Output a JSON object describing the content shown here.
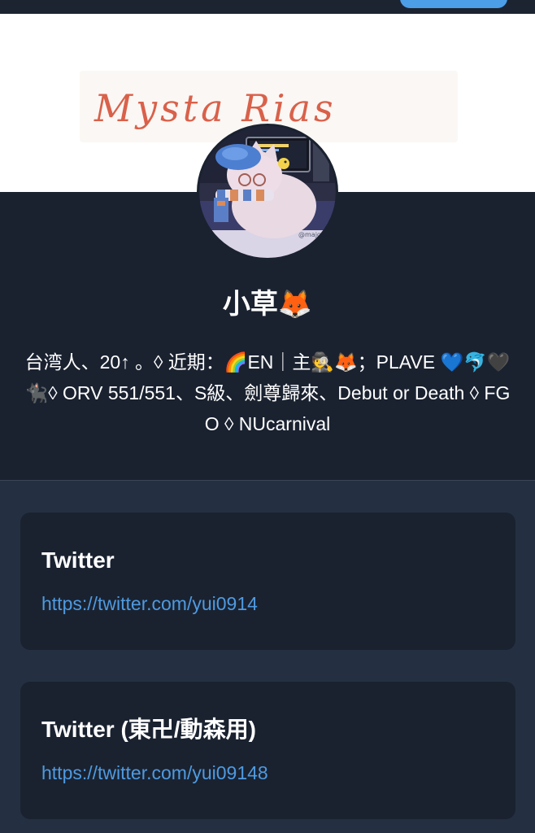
{
  "banner": {
    "logo_text": "Mysta Rias"
  },
  "profile": {
    "name": "小草🦊",
    "bio": "台湾人、20↑ 。◊ 近期：🌈EN｜主🕵🦊；PLAVE 💙🐬🖤🐈‍⬛◊ ORV 551/551、S級、劍尊歸來、Debut or Death ◊ FGO ◊ NUcarnival"
  },
  "links": [
    {
      "title": "Twitter",
      "url": "https://twitter.com/yui0914"
    },
    {
      "title": "Twitter (東卍/動森用)",
      "url": "https://twitter.com/yui09148"
    }
  ],
  "colors": {
    "background": "#243041",
    "card": "#1a2230",
    "link": "#4f9ae0",
    "accent_button": "#4c9ee6",
    "banner": "#ffffff",
    "logo": "#d9614a"
  }
}
